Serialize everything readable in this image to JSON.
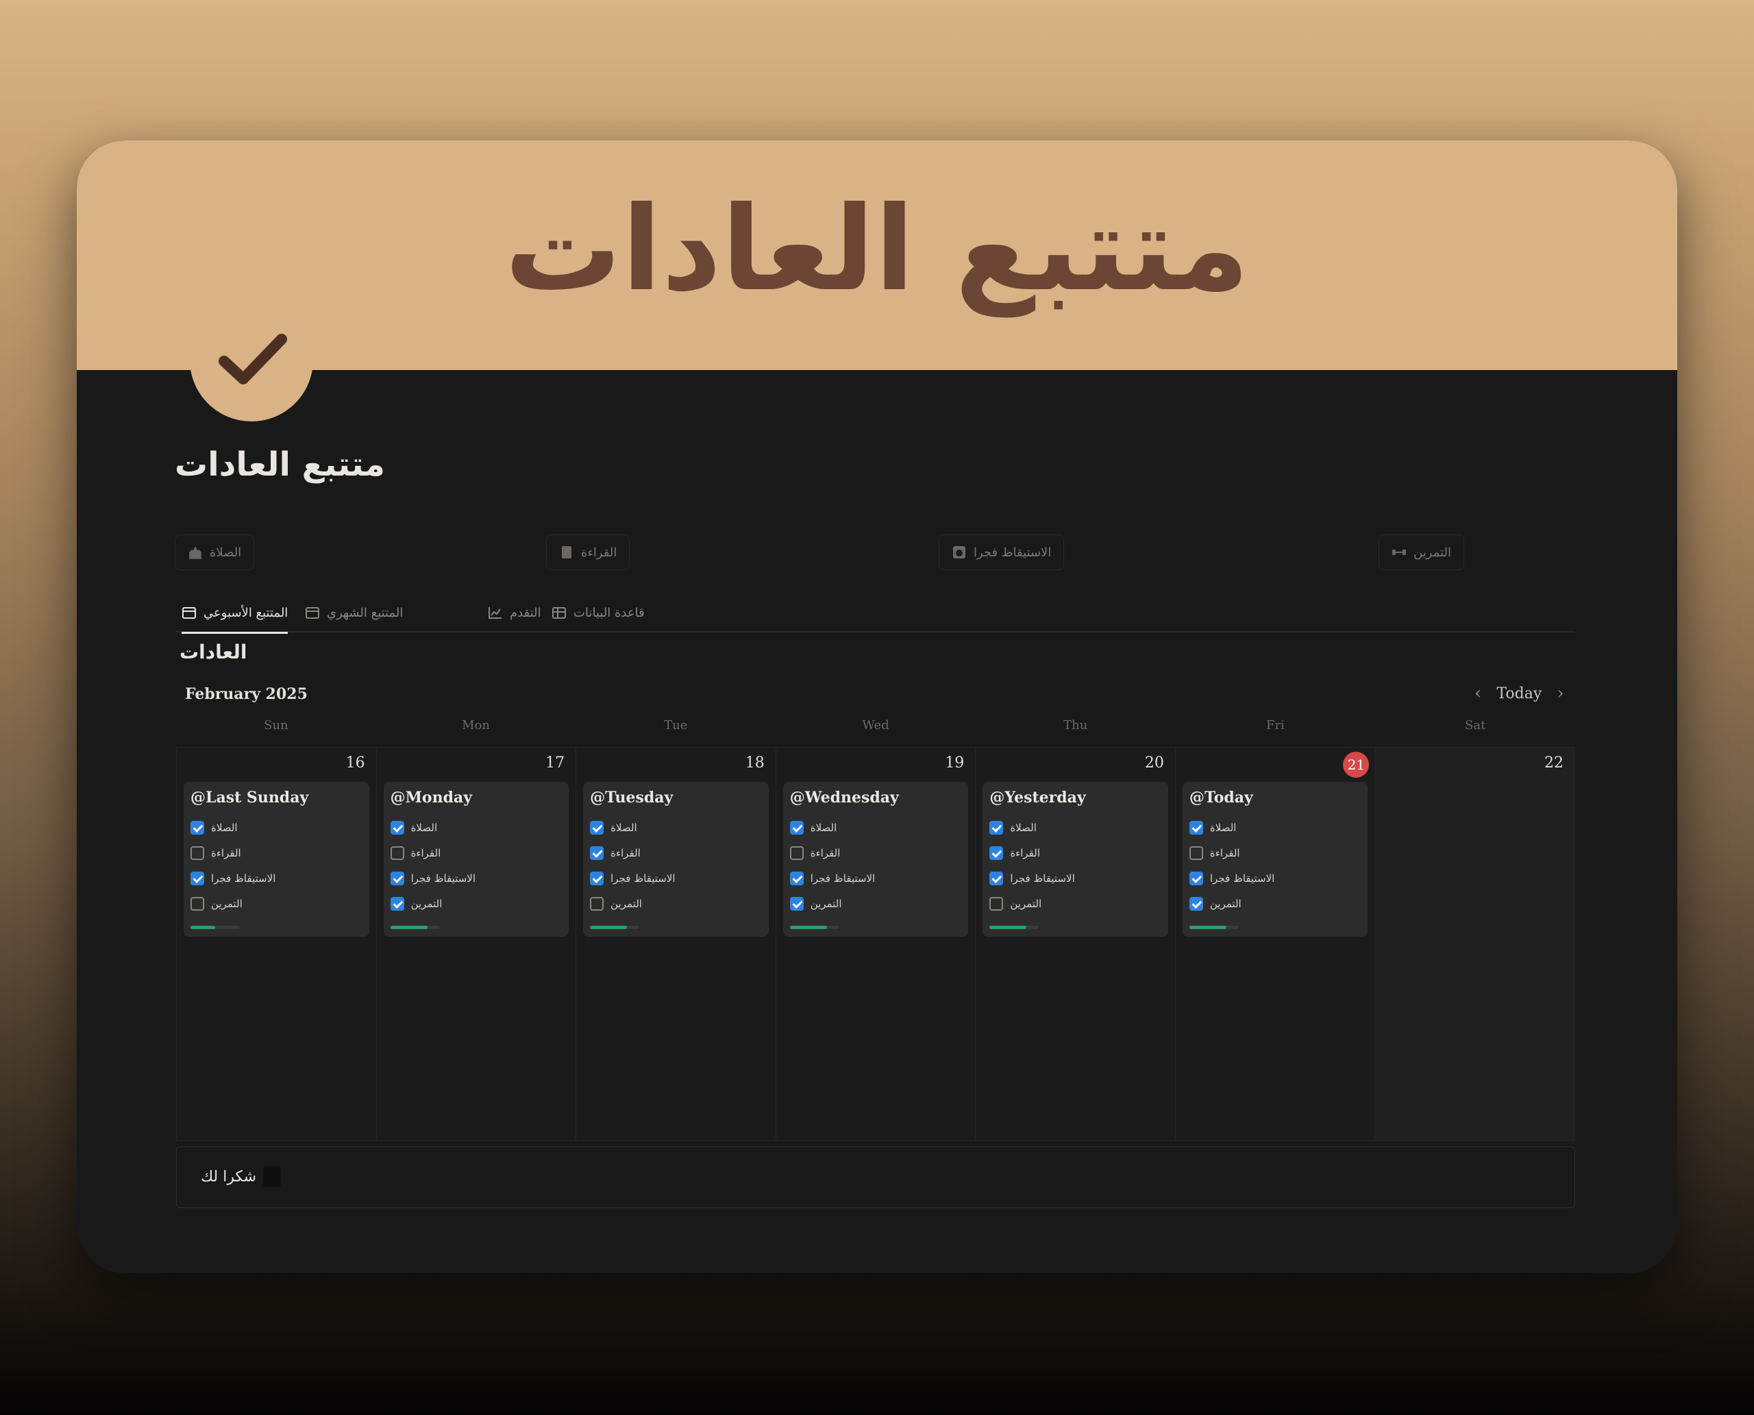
{
  "banner": {
    "title": "متتبع العادات"
  },
  "page": {
    "title": "متتبع العادات"
  },
  "chips": [
    {
      "label": "الصلاة",
      "icon": "mosque-icon"
    },
    {
      "label": "القراءة",
      "icon": "book-icon"
    },
    {
      "label": "الاستيقاظ فجرا",
      "icon": "alarm-icon"
    },
    {
      "label": "التمرين",
      "icon": "dumbbell-icon"
    }
  ],
  "tabs": [
    {
      "label": "المتتبع الأسبوعي",
      "icon": "calendar-icon",
      "active": true
    },
    {
      "label": "المتتبع الشهري",
      "icon": "calendar-icon",
      "active": false
    },
    {
      "label": "التقدم",
      "icon": "chart-icon",
      "active": false
    },
    {
      "label": "قاعدة البيانات",
      "icon": "table-icon",
      "active": false
    }
  ],
  "section": {
    "label": "العادات"
  },
  "calendar": {
    "month": "February 2025",
    "today_label": "Today",
    "weekdays": [
      "Sun",
      "Mon",
      "Tue",
      "Wed",
      "Thu",
      "Fri",
      "Sat"
    ],
    "days": [
      {
        "num": "16",
        "title": "@Last Sunday",
        "habits": [
          true,
          false,
          true,
          false
        ],
        "progress": 0.5
      },
      {
        "num": "17",
        "title": "@Monday",
        "habits": [
          true,
          false,
          true,
          true
        ],
        "progress": 0.75
      },
      {
        "num": "18",
        "title": "@Tuesday",
        "habits": [
          true,
          true,
          true,
          false
        ],
        "progress": 0.75
      },
      {
        "num": "19",
        "title": "@Wednesday",
        "habits": [
          true,
          false,
          true,
          true
        ],
        "progress": 0.75
      },
      {
        "num": "20",
        "title": "@Yesterday",
        "habits": [
          true,
          true,
          true,
          false
        ],
        "progress": 0.75
      },
      {
        "num": "21",
        "title": "@Today",
        "habits": [
          true,
          false,
          true,
          true
        ],
        "progress": 0.75,
        "is_today": true
      },
      {
        "num": "22"
      }
    ],
    "habit_names": [
      "الصلاة",
      "القراءة",
      "الاستيقاظ فجرا",
      "التمرين"
    ]
  },
  "footer": {
    "label": "شكرا لك"
  },
  "colors": {
    "accent": "#d9b385",
    "banner_text": "#6b4634",
    "checkbox": "#2d84e0",
    "today": "#d8494a",
    "progress": "#2e9c6a"
  }
}
